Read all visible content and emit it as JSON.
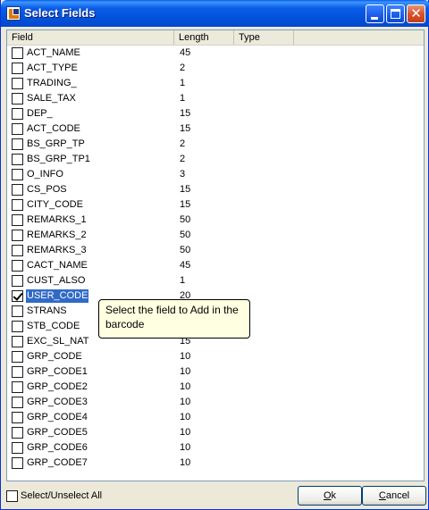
{
  "window": {
    "title": "Select Fields"
  },
  "columns": {
    "field": "Field",
    "length": "Length",
    "type": "Type"
  },
  "rows": [
    {
      "field": "ACT_NAME",
      "length": "45",
      "checked": false
    },
    {
      "field": "ACT_TYPE",
      "length": "2",
      "checked": false
    },
    {
      "field": "TRADING_",
      "length": "1",
      "checked": false
    },
    {
      "field": "SALE_TAX",
      "length": "1",
      "checked": false
    },
    {
      "field": "DEP_",
      "length": "15",
      "checked": false
    },
    {
      "field": "ACT_CODE",
      "length": "15",
      "checked": false
    },
    {
      "field": "BS_GRP_TP",
      "length": "2",
      "checked": false
    },
    {
      "field": "BS_GRP_TP1",
      "length": "2",
      "checked": false
    },
    {
      "field": "O_INFO",
      "length": "3",
      "checked": false
    },
    {
      "field": "CS_POS",
      "length": "15",
      "checked": false
    },
    {
      "field": "CITY_CODE",
      "length": "15",
      "checked": false
    },
    {
      "field": "REMARKS_1",
      "length": "50",
      "checked": false
    },
    {
      "field": "REMARKS_2",
      "length": "50",
      "checked": false
    },
    {
      "field": "REMARKS_3",
      "length": "50",
      "checked": false
    },
    {
      "field": "CACT_NAME",
      "length": "45",
      "checked": false
    },
    {
      "field": "CUST_ALSO",
      "length": "1",
      "checked": false
    },
    {
      "field": "USER_CODE",
      "length": "20",
      "checked": true,
      "selected": true
    },
    {
      "field": "STRANS",
      "length": "",
      "checked": false
    },
    {
      "field": "STB_CODE",
      "length": "",
      "checked": false
    },
    {
      "field": "EXC_SL_NAT",
      "length": "15",
      "checked": false
    },
    {
      "field": "GRP_CODE",
      "length": "10",
      "checked": false
    },
    {
      "field": "GRP_CODE1",
      "length": "10",
      "checked": false
    },
    {
      "field": "GRP_CODE2",
      "length": "10",
      "checked": false
    },
    {
      "field": "GRP_CODE3",
      "length": "10",
      "checked": false
    },
    {
      "field": "GRP_CODE4",
      "length": "10",
      "checked": false
    },
    {
      "field": "GRP_CODE5",
      "length": "10",
      "checked": false
    },
    {
      "field": "GRP_CODE6",
      "length": "10",
      "checked": false
    },
    {
      "field": "GRP_CODE7",
      "length": "10",
      "checked": false
    }
  ],
  "tooltip": {
    "text": "Select the field to Add in the barcode"
  },
  "footer": {
    "select_all_label": "Select/Unselect All",
    "ok_label": "Ok",
    "cancel_label": "Cancel"
  },
  "colors": {
    "titlebar": "#0251d9",
    "selection": "#316ac5",
    "tooltip_bg": "#ffffe1"
  },
  "icons": {
    "app": "app-icon",
    "minimize": "minimize-icon",
    "maximize": "maximize-icon",
    "close": "close-icon"
  }
}
